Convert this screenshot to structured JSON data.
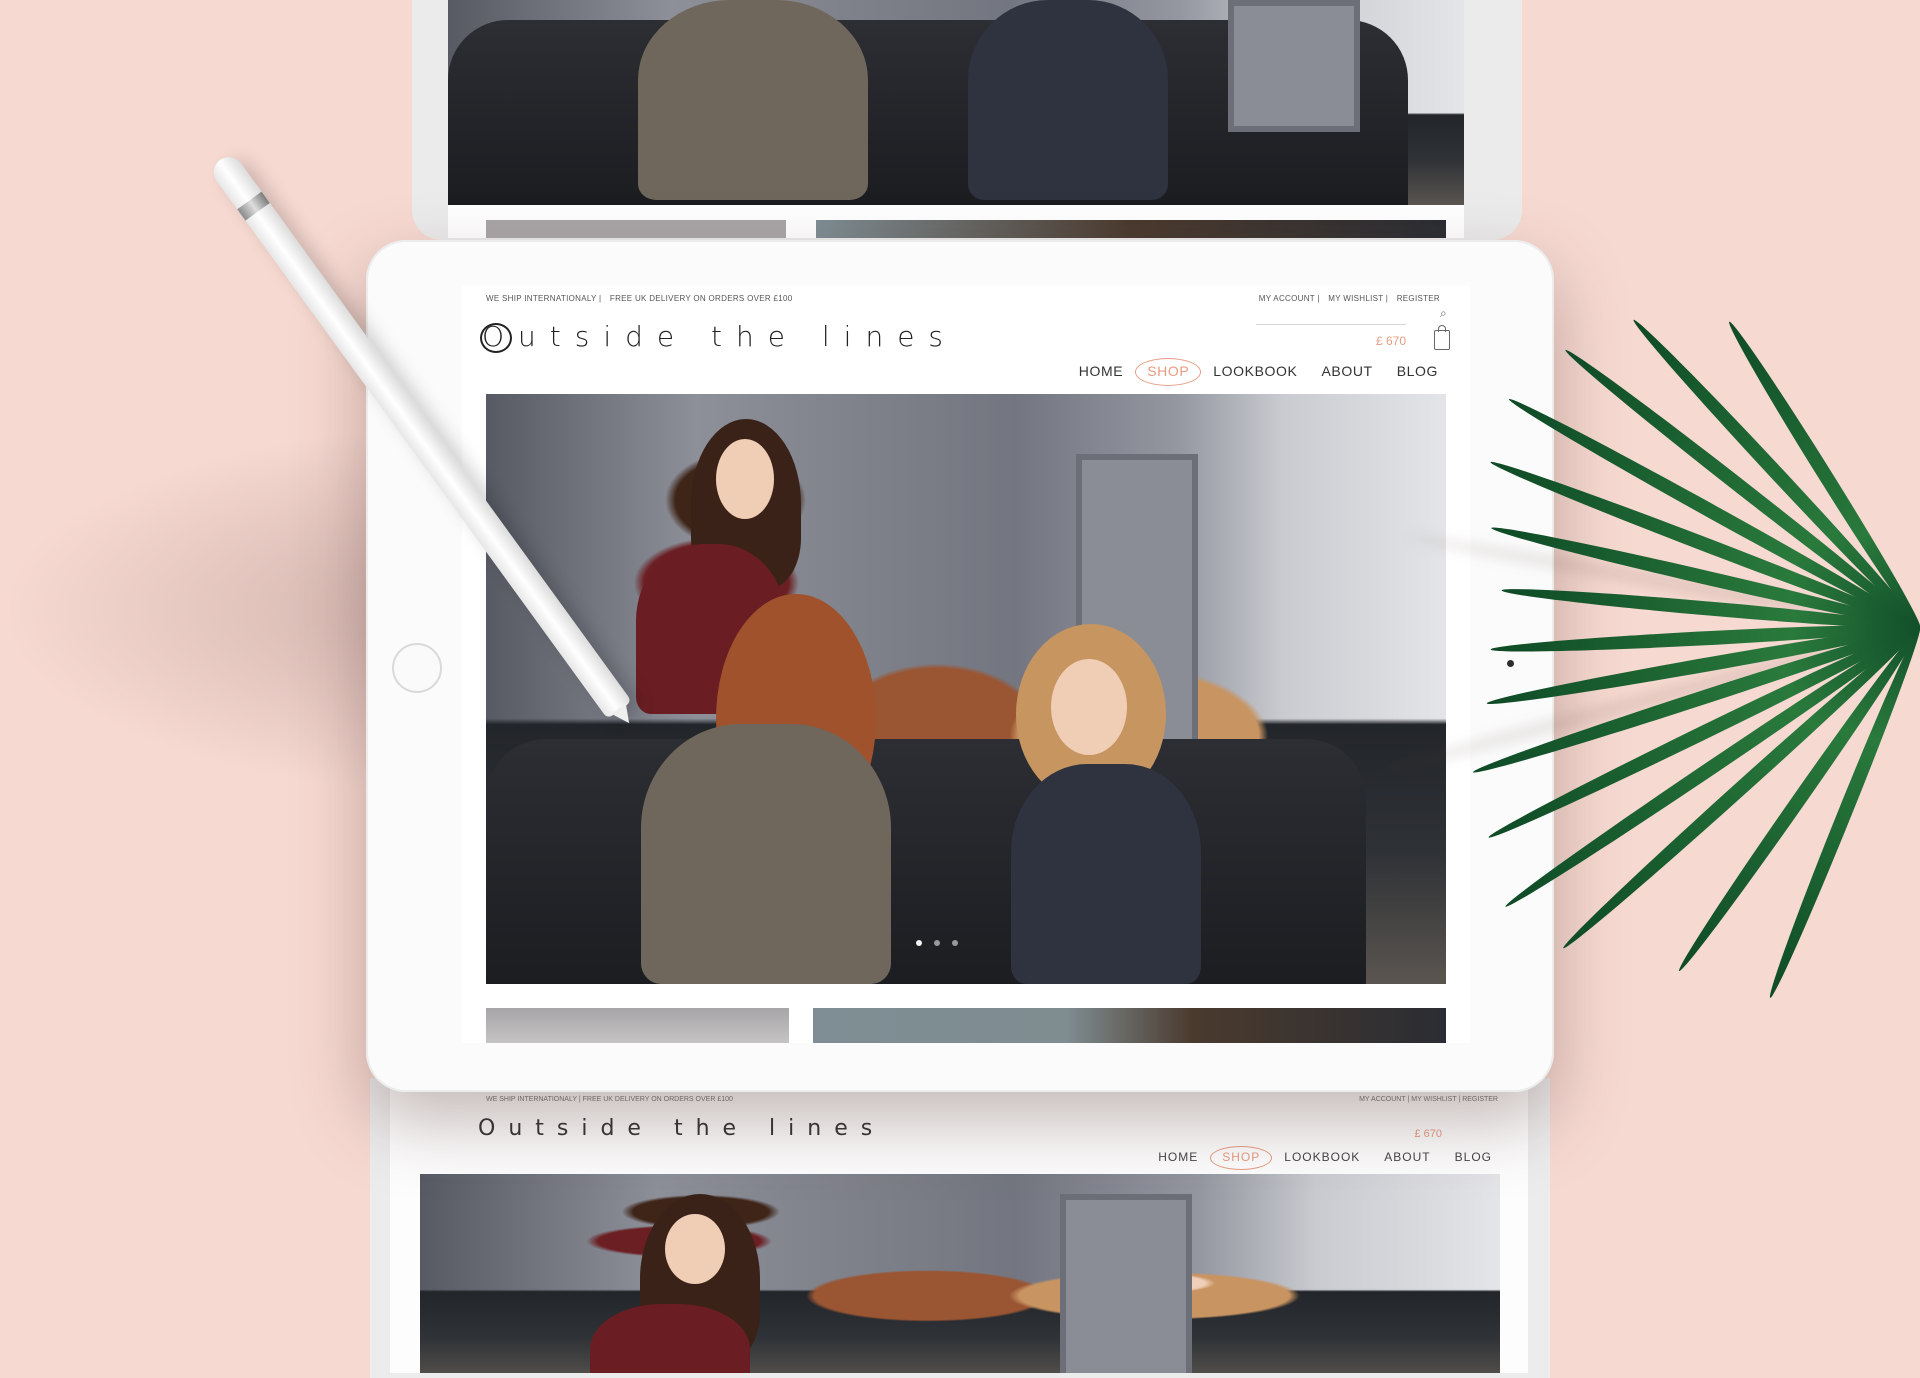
{
  "site": {
    "topbar_left": [
      "WE SHIP INTERNATIONALY |",
      "FREE UK DELIVERY ON ORDERS OVER £100"
    ],
    "topbar_right": [
      "MY ACCOUNT |",
      "MY WISHLIST |",
      "REGISTER"
    ],
    "logo": "Outside the lines",
    "cart_total": "£ 670",
    "nav": [
      {
        "label": "HOME",
        "active": false
      },
      {
        "label": "SHOP",
        "active": true
      },
      {
        "label": "LOOKBOOK",
        "active": false
      },
      {
        "label": "ABOUT",
        "active": false
      },
      {
        "label": "BLOG",
        "active": false
      }
    ],
    "slider_dots": 3,
    "slider_active": 0
  },
  "colors": {
    "background": "#f6d9d1",
    "accent": "#e79c82",
    "palm": "#1f6b35"
  },
  "icons": [
    "search-icon",
    "shopping-bag-icon",
    "home-button-icon",
    "camera-icon"
  ]
}
